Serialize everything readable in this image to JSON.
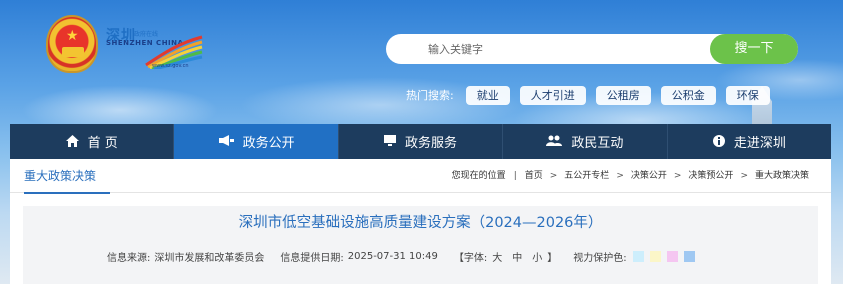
{
  "header": {
    "logo_title": "深圳",
    "logo_subtitle": "政府在线",
    "logo_english": "SHENZHEN CHINA",
    "logo_url": "www.sz.gov.cn",
    "search_placeholder": "输入关键字",
    "search_button": "搜一下"
  },
  "hot_search": {
    "label": "热门搜索:",
    "tags": [
      "就业",
      "人才引进",
      "公租房",
      "公积金",
      "环保"
    ]
  },
  "nav": {
    "items": [
      {
        "label": "首 页",
        "icon": "home-icon"
      },
      {
        "label": "政务公开",
        "icon": "megaphone-icon"
      },
      {
        "label": "政务服务",
        "icon": "monitor-icon"
      },
      {
        "label": "政民互动",
        "icon": "people-icon"
      },
      {
        "label": "走进深圳",
        "icon": "info-icon"
      }
    ],
    "active_index": 1
  },
  "breadcrumb": {
    "section": "重大政策决策",
    "prefix": "您现在的位置",
    "items": [
      "首页",
      "五公开专栏",
      "决策公开",
      "决策预公开",
      "重大政策决策"
    ]
  },
  "article": {
    "title": "深圳市低空基础设施高质量建设方案（2024—2026年）",
    "source_label": "信息来源:",
    "source": "深圳市发展和改革委员会",
    "date_label": "信息提供日期:",
    "date": "2025-07-31 10:49",
    "font_label_open": "【字体:",
    "font_sizes": [
      "大",
      "中",
      "小"
    ],
    "font_label_close": "】",
    "eye_label": "视力保护色:",
    "eye_colors": [
      "#cdeefc",
      "#fbf6c8",
      "#f5c6f1",
      "#9fc8f2"
    ]
  },
  "colors": {
    "nav_bg": "#1d3c5e",
    "nav_active": "#2170c4",
    "search_button": "#6cc24a",
    "link_blue": "#2a6fbd"
  }
}
